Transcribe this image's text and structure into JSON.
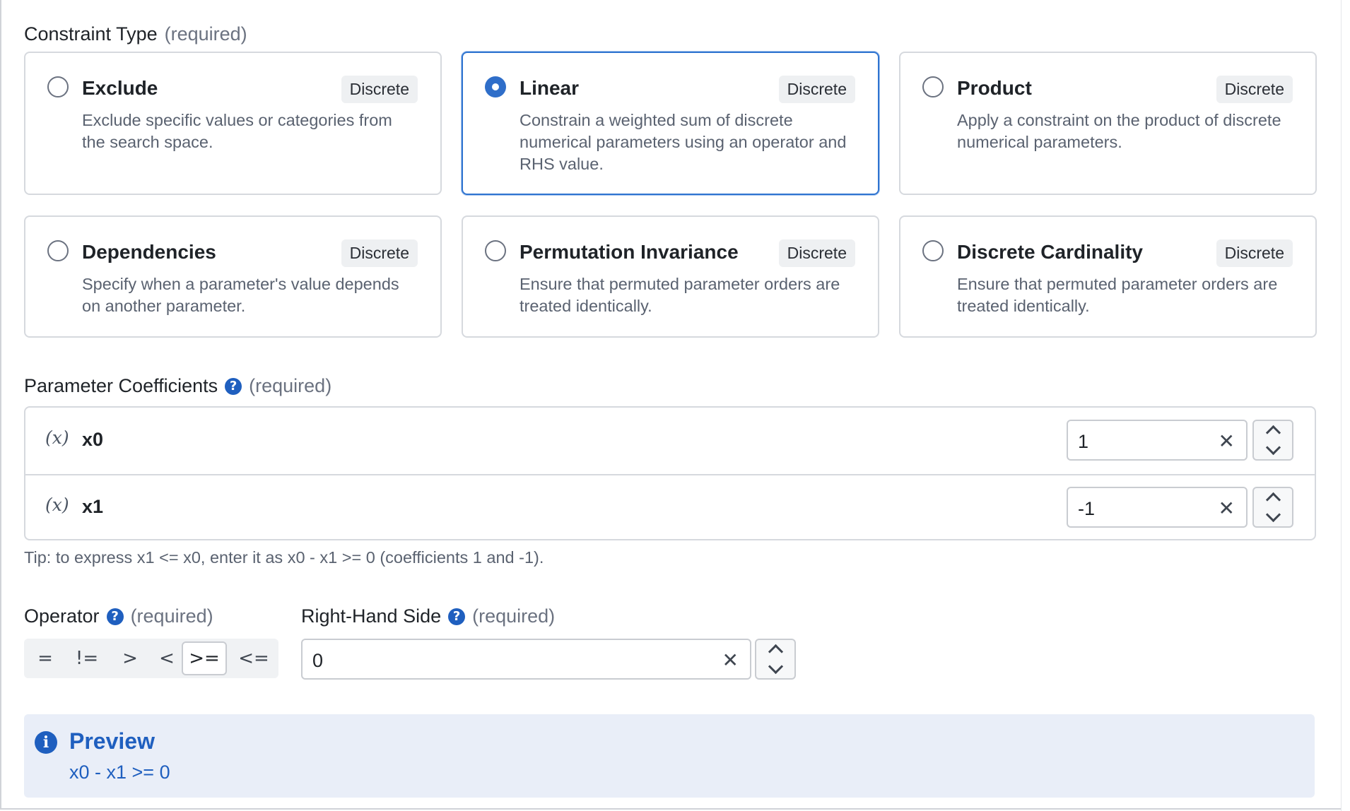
{
  "constraint_type": {
    "label": "Constraint Type",
    "required": "(required)",
    "options": [
      {
        "title": "Exclude",
        "badge": "Discrete",
        "description": "Exclude specific values or categories from the search space.",
        "selected": false
      },
      {
        "title": "Linear",
        "badge": "Discrete",
        "description": "Constrain a weighted sum of discrete numerical parameters using an operator and RHS value.",
        "selected": true
      },
      {
        "title": "Product",
        "badge": "Discrete",
        "description": "Apply a constraint on the product of discrete numerical parameters.",
        "selected": false
      },
      {
        "title": "Dependencies",
        "badge": "Discrete",
        "description": "Specify when a parameter's value depends on another parameter.",
        "selected": false
      },
      {
        "title": "Permutation Invariance",
        "badge": "Discrete",
        "description": "Ensure that permuted parameter orders are treated identically.",
        "selected": false
      },
      {
        "title": "Discrete Cardinality",
        "badge": "Discrete",
        "description": "Ensure that permuted parameter orders are treated identically.",
        "selected": false
      }
    ]
  },
  "coefficients": {
    "label": "Parameter Coefficients",
    "required": "(required)",
    "var_icon": "(x)",
    "rows": [
      {
        "name": "x0",
        "value": "1"
      },
      {
        "name": "x1",
        "value": "-1"
      }
    ],
    "tip": "Tip: to express x1 <= x0, enter it as x0 - x1 >= 0 (coefficients 1 and -1)."
  },
  "operator": {
    "label": "Operator",
    "required": "(required)",
    "options": [
      "=",
      "!=",
      ">",
      "<",
      ">=",
      "<="
    ],
    "selected": ">="
  },
  "rhs": {
    "label": "Right-Hand Side",
    "required": "(required)",
    "value": "0"
  },
  "preview": {
    "title": "Preview",
    "expression": "x0 - x1 >= 0"
  },
  "icons": {
    "help": "?",
    "info": "i",
    "clear": "✕"
  },
  "colors": {
    "accent": "#2f6ec9",
    "preview_bg": "#e9eef8",
    "preview_text": "#1f5fbf"
  }
}
